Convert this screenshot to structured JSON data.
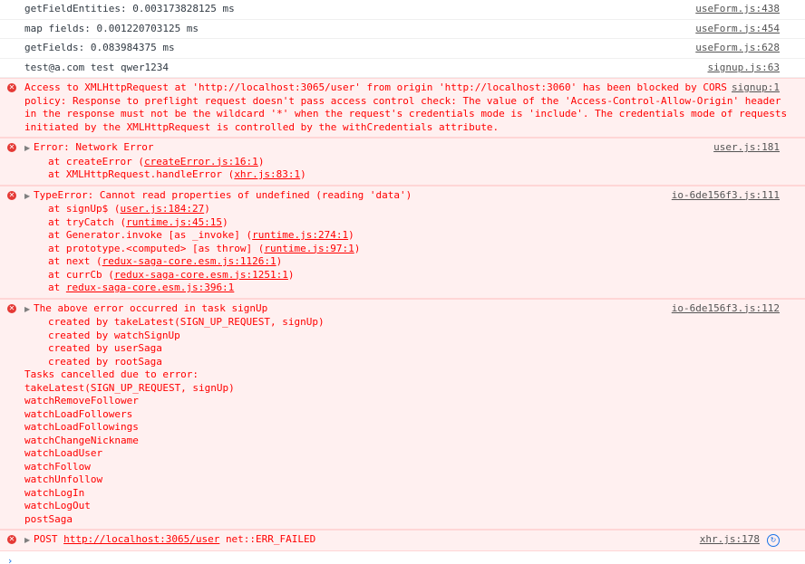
{
  "logs": [
    {
      "text": "getFieldEntities: 0.003173828125 ms",
      "source": "useForm.js:438"
    },
    {
      "text": "map fields: 0.001220703125 ms",
      "source": "useForm.js:454"
    },
    {
      "text": "getFields: 0.083984375 ms",
      "source": "useForm.js:628"
    },
    {
      "text": "test@a.com test qwer1234",
      "source": "signup.js:63"
    }
  ],
  "cors_error": {
    "icon": "error-icon",
    "source": "signup:1",
    "lines": [
      "Access to XMLHttpRequest at 'http://localhost:3065/user' from origin 'http://localhost:3060' has been blocked by CORS",
      "policy: Response to preflight request doesn't pass access control check: The value of the 'Access-Control-Allow-Origin' header",
      "in the response must not be the wildcard '*' when the request's credentials mode is 'include'. The credentials mode of requests",
      "initiated by the XMLHttpRequest is controlled by the withCredentials attribute."
    ]
  },
  "network_error": {
    "title": "Error: Network Error",
    "source": "user.js:181",
    "frames": [
      {
        "fn": "at createError (",
        "loc": "createError.js:16:1",
        "end": ")"
      },
      {
        "fn": "at XMLHttpRequest.handleError (",
        "loc": "xhr.js:83:1",
        "end": ")"
      }
    ]
  },
  "type_error": {
    "title": "TypeError: Cannot read properties of undefined (reading 'data')",
    "source": "io-6de156f3.js:111",
    "frames": [
      {
        "fn": "at signUp$ (",
        "loc": "user.js:184:27",
        "end": ")"
      },
      {
        "fn": "at tryCatch (",
        "loc": "runtime.js:45:15",
        "end": ")"
      },
      {
        "fn": "at Generator.invoke [as _invoke] (",
        "loc": "runtime.js:274:1",
        "end": ")"
      },
      {
        "fn": "at prototype.<computed> [as throw] (",
        "loc": "runtime.js:97:1",
        "end": ")"
      },
      {
        "fn": "at next (",
        "loc": "redux-saga-core.esm.js:1126:1",
        "end": ")"
      },
      {
        "fn": "at currCb (",
        "loc": "redux-saga-core.esm.js:1251:1",
        "end": ")"
      },
      {
        "fn": "at ",
        "loc": "redux-saga-core.esm.js:396:1",
        "end": ""
      }
    ]
  },
  "saga_error": {
    "title": "The above error occurred in task signUp",
    "source": "io-6de156f3.js:112",
    "created_by": [
      "created by takeLatest(SIGN_UP_REQUEST, signUp)",
      "created by watchSignUp",
      "created by userSaga",
      "created by rootSaga"
    ],
    "tasks_header": "Tasks cancelled due to error:",
    "tasks": [
      "takeLatest(SIGN_UP_REQUEST, signUp)",
      "watchRemoveFollower",
      "watchLoadFollowers",
      "watchLoadFollowings",
      "watchChangeNickname",
      "watchLoadUser",
      "watchFollow",
      "watchUnfollow",
      "watchLogIn",
      "watchLogOut",
      "postSaga"
    ]
  },
  "post_error": {
    "method": "POST",
    "url": "http://localhost:3065/user",
    "status": "net::ERR_FAILED",
    "source": "xhr.js:178"
  },
  "prompt": "›"
}
